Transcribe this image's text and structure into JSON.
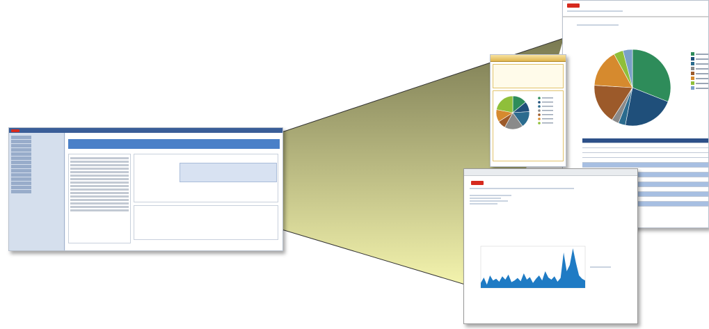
{
  "colors": {
    "pie": [
      "#2e8c5a",
      "#1f4f7a",
      "#2b6b8e",
      "#8a8a8a",
      "#9c5a2a",
      "#d68a2e",
      "#8fbf3a",
      "#7aa0c8"
    ],
    "area": "#1f7bc4",
    "beam_top": "#7a7a52",
    "beam_bottom": "#f7f7b0",
    "oracle_red": "#d62a1e"
  },
  "report": {
    "pie_values": [
      31,
      22,
      3,
      3,
      17,
      16,
      4,
      4
    ]
  },
  "mid": {
    "pie_values": [
      14,
      10,
      16,
      18,
      8,
      12,
      22
    ]
  },
  "vol": {
    "area_values": [
      12,
      25,
      8,
      30,
      18,
      22,
      15,
      28,
      20,
      32,
      14,
      18,
      24,
      16,
      35,
      20,
      26,
      12,
      22,
      30,
      18,
      40,
      25,
      20,
      28,
      15,
      24,
      85,
      40,
      55,
      95,
      60,
      30,
      22,
      18
    ]
  }
}
